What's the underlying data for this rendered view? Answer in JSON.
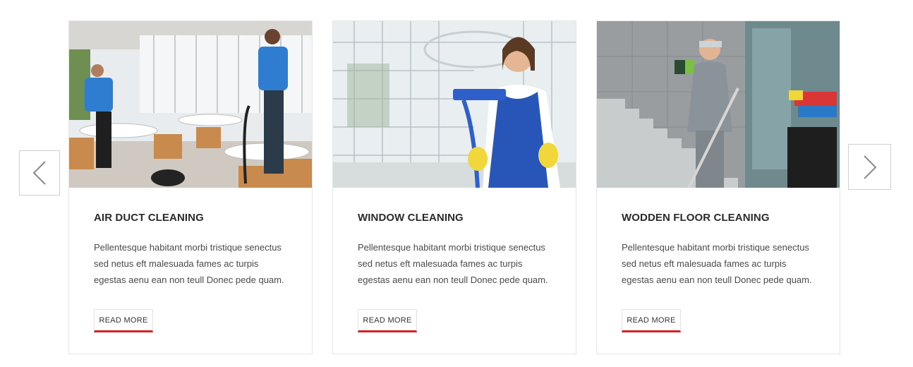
{
  "carousel": {
    "prev_icon": "chevron-left-icon",
    "next_icon": "chevron-right-icon",
    "accent_color": "#d71f27",
    "cards": [
      {
        "title": "AIR DUCT CLEANING",
        "text": "Pellentesque habitant morbi tristique senectus sed netus eft malesuada fames ac turpis egestas aenu ean non teull Donec pede quam.",
        "button": "READ MORE",
        "image": "cleaning-crew-cafeteria-photo"
      },
      {
        "title": "WINDOW CLEANING",
        "text": "Pellentesque habitant morbi tristique senectus sed netus eft malesuada fames ac turpis egestas aenu ean non teull Donec pede quam.",
        "button": "READ MORE",
        "image": "woman-with-mop-atrium-photo"
      },
      {
        "title": "WODDEN FLOOR CLEANING",
        "text": "Pellentesque habitant morbi tristique senectus sed netus eft malesuada fames ac turpis egestas aenu ean non teull Donec pede quam.",
        "button": "READ MORE",
        "image": "cleaner-mopping-stairwell-photo"
      }
    ]
  }
}
